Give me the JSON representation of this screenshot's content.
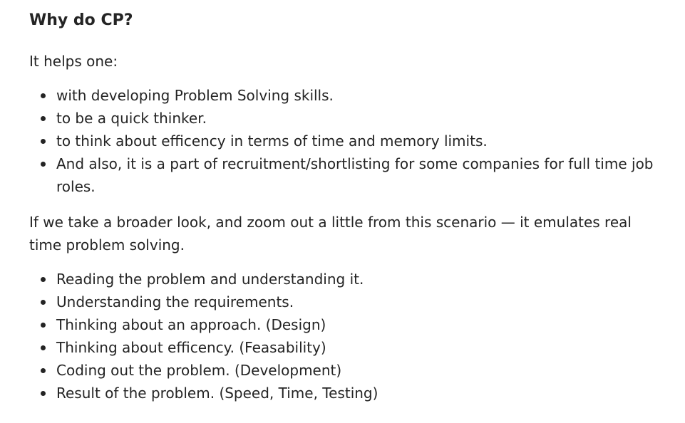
{
  "heading": "Why do CP?",
  "intro": "It helps one:",
  "benefits": [
    "with developing Problem Solving skills.",
    "to be a quick thinker.",
    "to think about efficency in terms of time and memory limits.",
    "And also, it is a part of recruitment/shortlisting for some companies for full time job roles."
  ],
  "broader_look": "If we take a broader look, and zoom out a little from this scenario — it emulates real time problem solving.",
  "steps": [
    "Reading the problem and understanding it.",
    "Understanding the requirements.",
    "Thinking about an approach. (Design)",
    "Thinking about efficency. (Feasability)",
    "Coding out the problem. (Development)",
    "Result of the problem. (Speed, Time, Testing)"
  ]
}
